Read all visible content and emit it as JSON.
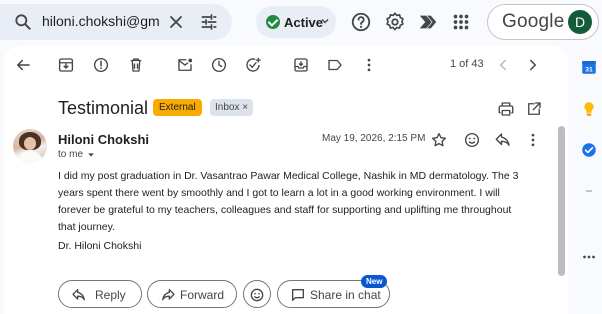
{
  "search": {
    "value": "hiloni.chokshi@gm",
    "search_icon": "search-icon",
    "clear_icon": "close-icon",
    "filter_icon": "tune-icon"
  },
  "status": {
    "label": "Active",
    "color": "#1e8e3e"
  },
  "topbar": {
    "icons": [
      "help-icon",
      "settings-icon",
      "gemini-icon",
      "apps-icon"
    ]
  },
  "account": {
    "brand": "Google",
    "avatar_letter": "D",
    "avatar_color": "#155a39"
  },
  "toolbar": {
    "icons": [
      "back-icon",
      "archive-icon",
      "report-spam-icon",
      "delete-icon",
      "mark-unread-icon",
      "snooze-icon",
      "add-task-icon",
      "move-to-icon",
      "label-icon",
      "more-icon"
    ],
    "pager": "1 of 43"
  },
  "email": {
    "subject": "Testimonial",
    "labels": {
      "external": "External",
      "inbox": "Inbox",
      "inbox_remove": "×"
    },
    "sender": "Hiloni Chokshi",
    "to": "to me",
    "date": "May 19, 2026, 2:15 PM",
    "body": "I did my post graduation in Dr. Vasantrao Pawar Medical College, Nashik in MD dermatology. The 3 years spent there went by smoothly and I got to learn a lot in a good working environment. I will forever be grateful to my teachers, colleagues and staff for supporting and uplifting me throughout that journey.",
    "signature": "Dr. Hiloni Chokshi"
  },
  "actions": {
    "reply": "Reply",
    "forward": "Forward",
    "share": "Share in chat",
    "new_badge": "New"
  },
  "side_panel": {
    "icons": [
      "calendar-icon",
      "keep-icon",
      "tasks-icon",
      "more-horiz-icon"
    ],
    "calendar_day": "31"
  },
  "colors": {
    "accent": "#0b57d0",
    "external_label": "#f9ab00",
    "background": "#f8fafd"
  }
}
